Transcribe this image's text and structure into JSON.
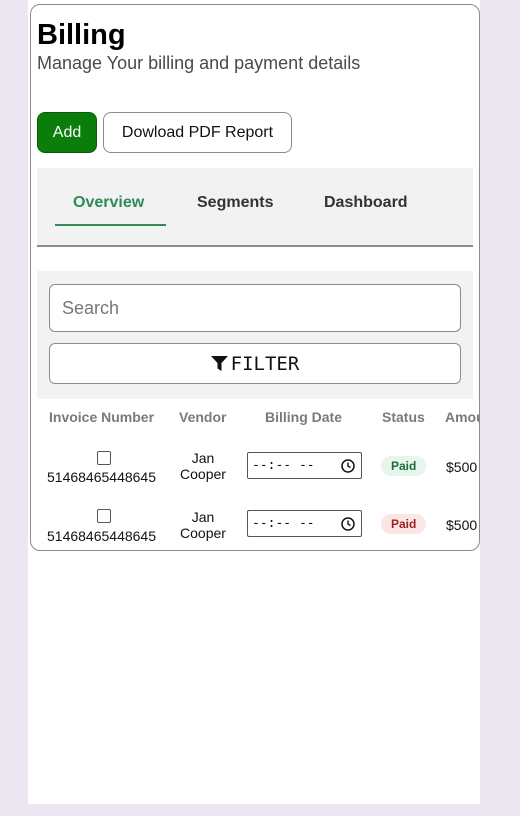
{
  "header": {
    "title": "Billing",
    "subtitle": "Manage Your billing and payment details"
  },
  "actions": {
    "add_label": "Add",
    "download_label": "Dowload PDF Report"
  },
  "tabs": [
    {
      "label": "Overview",
      "active": true
    },
    {
      "label": "Segments",
      "active": false
    },
    {
      "label": "Dashboard",
      "active": false
    }
  ],
  "search": {
    "placeholder": "Search",
    "value": ""
  },
  "filter": {
    "label": "FILTER",
    "icon": "funnel-icon"
  },
  "table": {
    "columns": [
      "Invoice Number",
      "Vendor",
      "Billing Date",
      "Status",
      "Amount"
    ],
    "rows": [
      {
        "invoice": "51468465448645",
        "vendor_first": "Jan",
        "vendor_last": "Cooper",
        "date_placeholder": "--:--  --",
        "status": "Paid",
        "status_color": "green",
        "amount": "$500"
      },
      {
        "invoice": "51468465448645",
        "vendor_first": "Jan",
        "vendor_last": "Cooper",
        "date_placeholder": "--:--  --",
        "status": "Paid",
        "status_color": "red",
        "amount": "$500"
      }
    ]
  },
  "colors": {
    "accent_green": "#0a7d0a",
    "tab_active": "#2e8b57",
    "background": "#ece6f1"
  }
}
